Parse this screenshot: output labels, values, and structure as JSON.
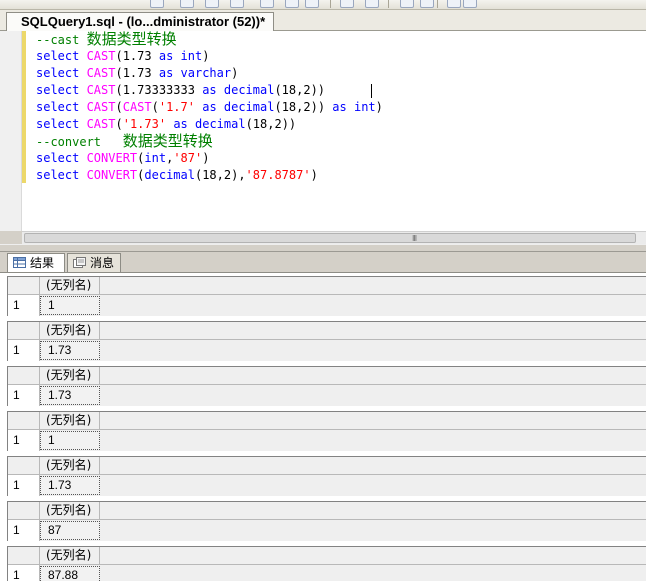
{
  "tab": {
    "title": "SQLQuery1.sql - (lo...dministrator (52))*"
  },
  "editor": {
    "lines": [
      [
        {
          "t": "--cast ",
          "c": "cm"
        },
        {
          "t": "数据类型转换",
          "c": "cm cjk"
        }
      ],
      [
        {
          "t": "select ",
          "c": "kw"
        },
        {
          "t": "CAST",
          "c": "fn"
        },
        {
          "t": "(1.73 "
        },
        {
          "t": "as",
          "c": "kw"
        },
        {
          "t": " "
        },
        {
          "t": "int",
          "c": "kw"
        },
        {
          "t": ")"
        }
      ],
      [
        {
          "t": "select ",
          "c": "kw"
        },
        {
          "t": "CAST",
          "c": "fn"
        },
        {
          "t": "(1.73 "
        },
        {
          "t": "as",
          "c": "kw"
        },
        {
          "t": " "
        },
        {
          "t": "varchar",
          "c": "kw"
        },
        {
          "t": ")"
        }
      ],
      [
        {
          "t": "select ",
          "c": "kw"
        },
        {
          "t": "CAST",
          "c": "fn"
        },
        {
          "t": "(1.73333333 "
        },
        {
          "t": "as",
          "c": "kw"
        },
        {
          "t": " "
        },
        {
          "t": "decimal",
          "c": "kw"
        },
        {
          "t": "(18,2))"
        }
      ],
      [
        {
          "t": "select ",
          "c": "kw"
        },
        {
          "t": "CAST",
          "c": "fn"
        },
        {
          "t": "("
        },
        {
          "t": "CAST",
          "c": "fn"
        },
        {
          "t": "("
        },
        {
          "t": "'1.7'",
          "c": "str"
        },
        {
          "t": " "
        },
        {
          "t": "as",
          "c": "kw"
        },
        {
          "t": " "
        },
        {
          "t": "decimal",
          "c": "kw"
        },
        {
          "t": "(18,2)) "
        },
        {
          "t": "as",
          "c": "kw"
        },
        {
          "t": " "
        },
        {
          "t": "int",
          "c": "kw"
        },
        {
          "t": ")"
        }
      ],
      [
        {
          "t": "select ",
          "c": "kw"
        },
        {
          "t": "CAST",
          "c": "fn"
        },
        {
          "t": "("
        },
        {
          "t": "'1.73'",
          "c": "str"
        },
        {
          "t": " "
        },
        {
          "t": "as",
          "c": "kw"
        },
        {
          "t": " "
        },
        {
          "t": "decimal",
          "c": "kw"
        },
        {
          "t": "(18,2))"
        }
      ],
      [
        {
          "t": "--convert   ",
          "c": "cm"
        },
        {
          "t": "数据类型转换",
          "c": "cm cjk"
        }
      ],
      [
        {
          "t": "select ",
          "c": "kw"
        },
        {
          "t": "CONVERT",
          "c": "fn"
        },
        {
          "t": "("
        },
        {
          "t": "int",
          "c": "kw"
        },
        {
          "t": ","
        },
        {
          "t": "'87'",
          "c": "str"
        },
        {
          "t": ")"
        }
      ],
      [
        {
          "t": "select ",
          "c": "kw"
        },
        {
          "t": "CONVERT",
          "c": "fn"
        },
        {
          "t": "("
        },
        {
          "t": "decimal",
          "c": "kw"
        },
        {
          "t": "(18,2),"
        },
        {
          "t": "'87.8787'",
          "c": "str"
        },
        {
          "t": ")"
        }
      ]
    ]
  },
  "scrollbar": {
    "grip": "III"
  },
  "results_tabs": [
    {
      "label": "结果",
      "icon": "grid-icon",
      "active": true
    },
    {
      "label": "消息",
      "icon": "messages-icon",
      "active": false
    }
  ],
  "result_sets": [
    {
      "column": "(无列名)",
      "row_number": "1",
      "value": "1"
    },
    {
      "column": "(无列名)",
      "row_number": "1",
      "value": "1.73"
    },
    {
      "column": "(无列名)",
      "row_number": "1",
      "value": "1.73"
    },
    {
      "column": "(无列名)",
      "row_number": "1",
      "value": "1"
    },
    {
      "column": "(无列名)",
      "row_number": "1",
      "value": "1.73"
    },
    {
      "column": "(无列名)",
      "row_number": "1",
      "value": "87"
    },
    {
      "column": "(无列名)",
      "row_number": "1",
      "value": "87.88"
    }
  ]
}
